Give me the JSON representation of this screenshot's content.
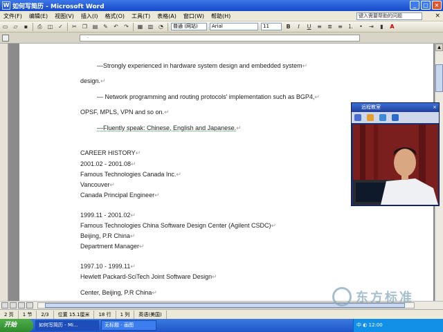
{
  "window": {
    "title": "如何写简历 - Microsoft Word"
  },
  "menu": {
    "items": [
      "文件(F)",
      "编辑(E)",
      "视图(V)",
      "插入(I)",
      "格式(O)",
      "工具(T)",
      "表格(A)",
      "窗口(W)",
      "帮助(H)"
    ],
    "help_placeholder": "键入需要帮助的问题"
  },
  "toolbar": {
    "style_value": "普通 (网站)",
    "font_value": "Arial",
    "size_value": "11",
    "bold": "B",
    "italic": "I",
    "underline": "U"
  },
  "document": {
    "lines": [
      {
        "text": "—Strongly experienced in hardware system design and embedded system",
        "indent": true
      },
      {
        "text": "design.",
        "indent": false
      },
      {
        "text": "— Network programming and routing protocols' implementation such as BGP4,",
        "indent": true
      },
      {
        "text": "OPSF, MPLS, VPN and so on.",
        "indent": false
      },
      {
        "text": "—Fluently speak: Chinese, English and Japanese.",
        "indent": true
      },
      {
        "text": "CAREER HISTORY",
        "indent": false
      },
      {
        "text": "2001.02 - 2001.08",
        "indent": false
      },
      {
        "text": "Famous Technologies Canada Inc.",
        "indent": false
      },
      {
        "text": "Vancouver",
        "indent": false
      },
      {
        "text": "Canada Principal Engineer",
        "indent": false
      },
      {
        "text": "1999.11 - 2001.02",
        "indent": false
      },
      {
        "text": "Famous Technologies China Software Design Center (Agilent CSDC)",
        "indent": false
      },
      {
        "text": "Beijing, P.R China",
        "indent": false
      },
      {
        "text": "Department Manager",
        "indent": false
      },
      {
        "text": "1997.10 - 1999.11",
        "indent": false
      },
      {
        "text": "Hewlett Packard-SciTech Joint Software Design",
        "indent": false
      },
      {
        "text": "Center, Beijing, P.R China",
        "indent": false
      }
    ]
  },
  "status": {
    "page": "2 页",
    "section": "1 节",
    "pages": "2/3",
    "position": "位置 15.1厘米",
    "line": "18 行",
    "col": "1 列",
    "language": "英语(美国)"
  },
  "video": {
    "title": "远程教室"
  },
  "taskbar": {
    "start": "开始",
    "tasks": [
      "如何写简历 - Mi...",
      "无标题 - 画图"
    ],
    "tray_text": "中 ◐ 12:00"
  },
  "watermark": {
    "text": "东方标准"
  }
}
